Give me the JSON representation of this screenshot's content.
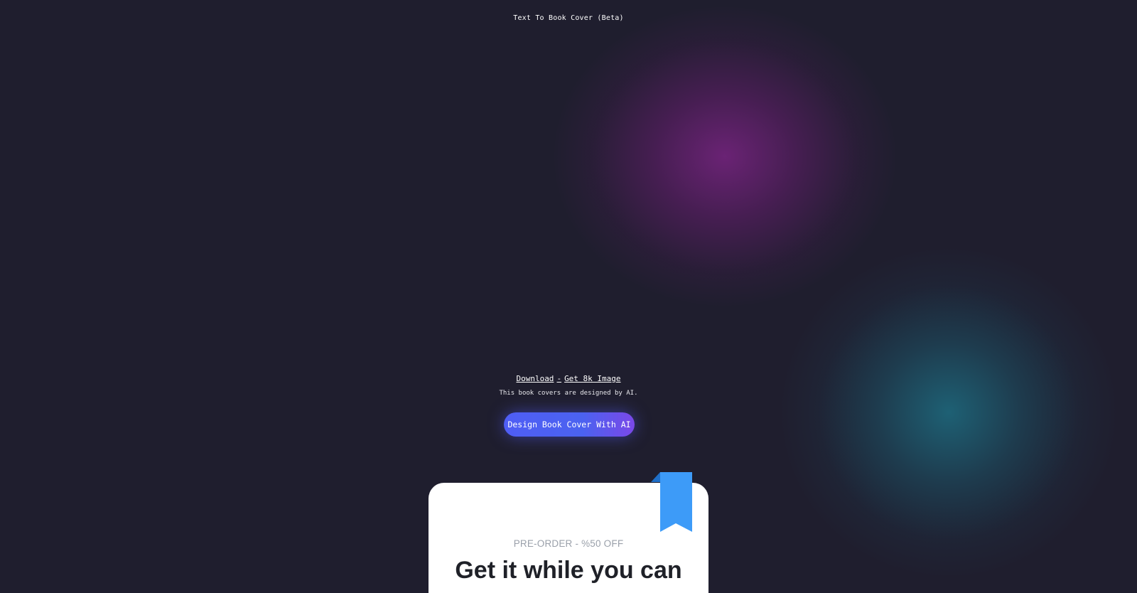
{
  "header": {
    "title": "Text To Book Cover (Beta)"
  },
  "links": {
    "download": "Download",
    "separator": "-",
    "get8k": "Get 8k Image"
  },
  "caption": "This book covers are designed by AI.",
  "cta": {
    "label": "Design Book Cover With AI"
  },
  "promo": {
    "badge_icon": "bookmark-icon",
    "eyebrow": "PRE-ORDER - %50 OFF",
    "headline": "Get it while you can"
  },
  "colors": {
    "background": "#1f1e2e",
    "cta_start": "#4f5ef5",
    "cta_end": "#7a48e8",
    "ribbon": "#3d9bf8",
    "glow_purple": "#6e2378",
    "glow_teal": "#1e6478"
  }
}
